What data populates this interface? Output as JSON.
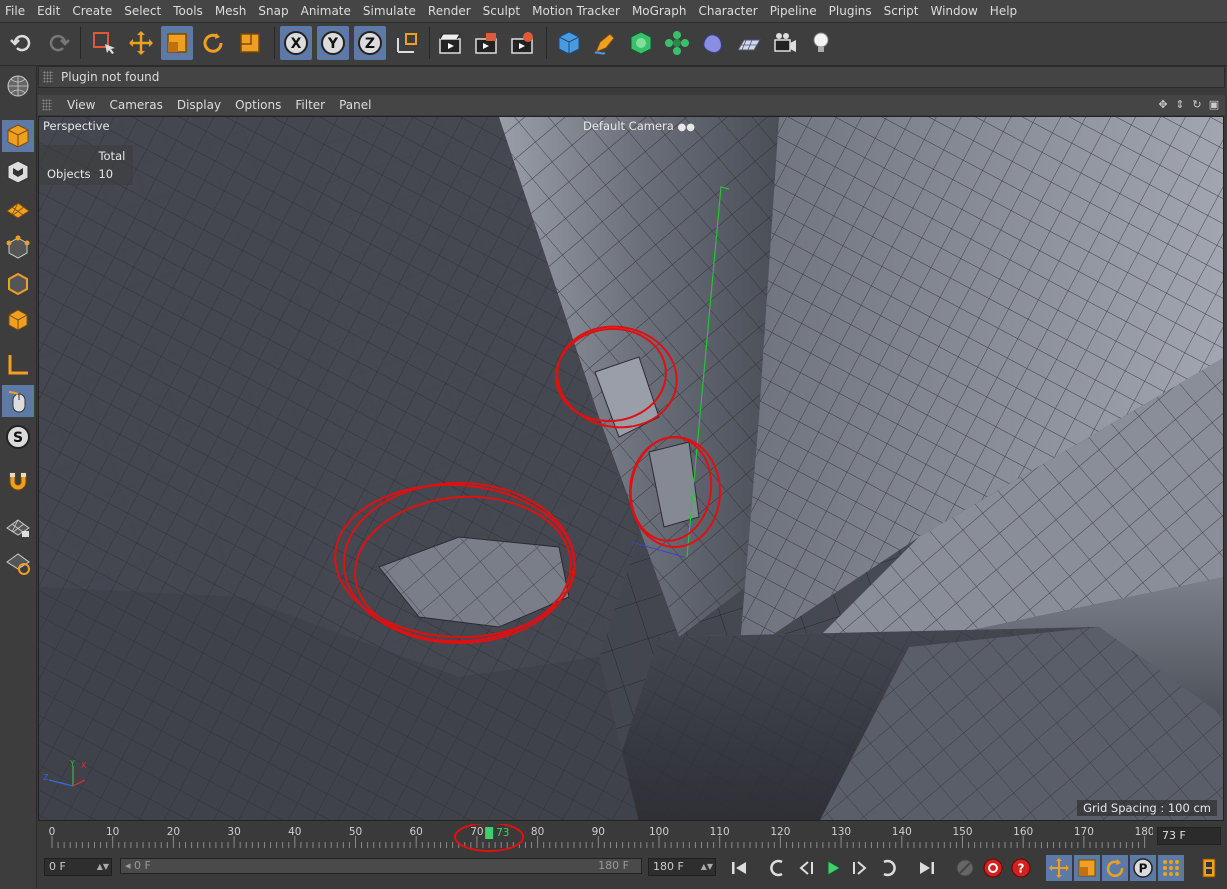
{
  "menu": [
    "File",
    "Edit",
    "Create",
    "Select",
    "Tools",
    "Mesh",
    "Snap",
    "Animate",
    "Simulate",
    "Render",
    "Sculpt",
    "Motion Tracker",
    "MoGraph",
    "Character",
    "Pipeline",
    "Plugins",
    "Script",
    "Window",
    "Help"
  ],
  "status": {
    "message": "Plugin not found"
  },
  "viewport_menu": [
    "View",
    "Cameras",
    "Display",
    "Options",
    "Filter",
    "Panel"
  ],
  "viewport": {
    "projection": "Perspective",
    "camera": "Default Camera",
    "stats_header": "Total",
    "stats_label": "Objects",
    "stats_value": "10",
    "grid_spacing": "Grid Spacing : 100 cm"
  },
  "timeline": {
    "ticks": [
      "0",
      "10",
      "20",
      "30",
      "40",
      "50",
      "60",
      "70",
      "80",
      "90",
      "100",
      "110",
      "120",
      "130",
      "140",
      "150",
      "160",
      "170",
      "180"
    ],
    "current_frame": "73",
    "current_frame_field": "73 F"
  },
  "range": {
    "start_field": "0 F",
    "slider_start": "0 F",
    "slider_end": "180 F",
    "end_field": "180 F"
  },
  "colors": {
    "accent": "#5d7aa6",
    "playhead": "#3ecf6e",
    "annotation": "#e01010",
    "icon_orange": "#f0a020"
  }
}
